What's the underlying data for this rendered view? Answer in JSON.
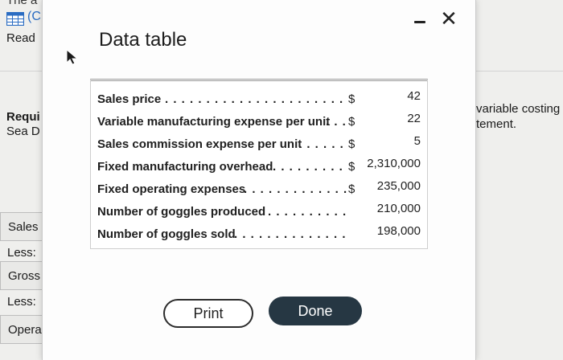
{
  "background": {
    "top_text": "The a",
    "paren": "(C",
    "read_label": "Read",
    "requirement_label": "Requi",
    "company_partial": "Sea D",
    "right_text_line1": "variable costing",
    "right_text_line2": "tement.",
    "rows": [
      "Sales",
      "Less:",
      "Gross",
      "Less:",
      "Opera"
    ]
  },
  "modal": {
    "title": "Data table",
    "minimize_glyph": "–",
    "close_glyph": "✕",
    "print_label": "Print",
    "done_label": "Done"
  },
  "table": {
    "rows": [
      {
        "label": "Sales price",
        "dots": ". . . . . . . . . . . . . . . . . . . . . . . . . .",
        "currency": "$",
        "value": "42"
      },
      {
        "label": "Variable manufacturing expense per unit",
        "dots": ". . .",
        "currency": "$",
        "value": "22"
      },
      {
        "label": "Sales commission expense per unit",
        "dots": ". . . . . . .",
        "currency": "$",
        "value": "5"
      },
      {
        "label": "Fixed manufacturing overhead",
        "dots": ". . . . . . . . . . .",
        "currency": "$",
        "value": "2,310,000"
      },
      {
        "label": "Fixed operating expenses",
        "dots": ". . . . . . . . . . . . . . . .",
        "currency": "$",
        "value": "235,000"
      },
      {
        "label": "Number of goggles produced",
        "dots": ". . . . . . . . . . . .",
        "currency": "",
        "value": "210,000"
      },
      {
        "label": "Number of goggles sold",
        "dots": ". . . . . . . . . . . . . . . . . .",
        "currency": "",
        "value": "198,000"
      }
    ]
  }
}
